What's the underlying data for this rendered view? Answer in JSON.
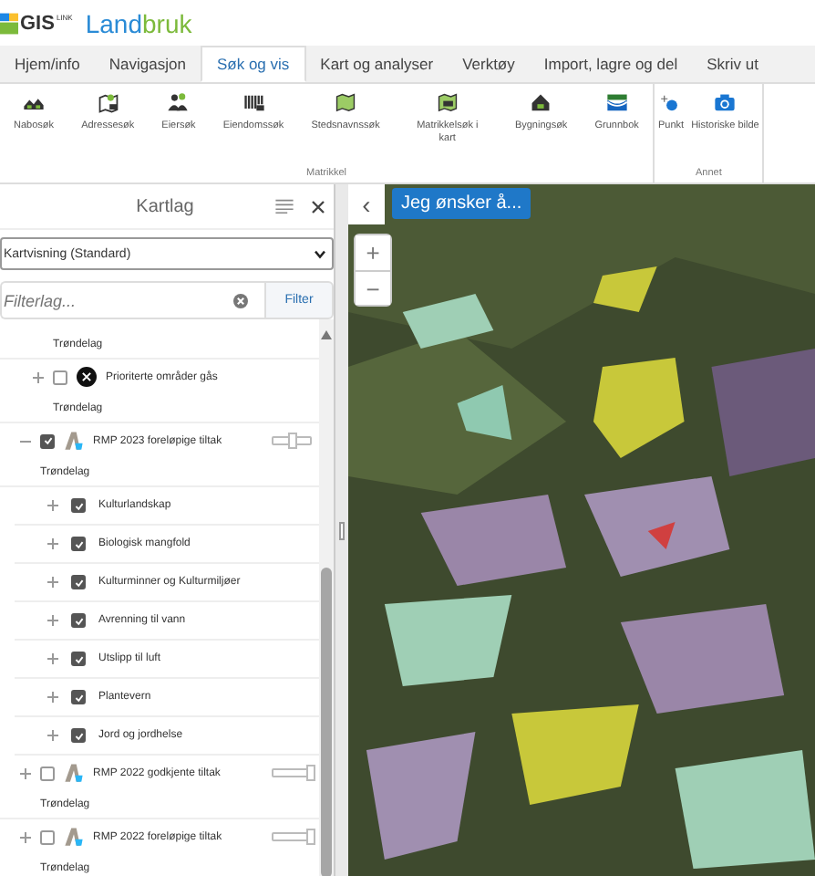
{
  "header": {
    "logo_text": "GIS",
    "logo_badge": "LINK",
    "app_name_parts": [
      "Land",
      "bruk"
    ]
  },
  "tabs": [
    {
      "label": "Hjem/info",
      "selected": false
    },
    {
      "label": "Navigasjon",
      "selected": false
    },
    {
      "label": "Søk og vis",
      "selected": true
    },
    {
      "label": "Kart og analyser",
      "selected": false
    },
    {
      "label": "Verktøy",
      "selected": false
    },
    {
      "label": "Import, lagre og del",
      "selected": false
    },
    {
      "label": "Skriv ut",
      "selected": false
    }
  ],
  "ribbon_groups": [
    {
      "label": "Matrikkel",
      "tools": [
        {
          "label": "Nabosøk"
        },
        {
          "label": "Adressesøk"
        },
        {
          "label": "Eiersøk"
        },
        {
          "label": "Eiendomssøk"
        },
        {
          "label": "Stedsnavnssøk"
        },
        {
          "label": "Matrikkelsøk i kart"
        },
        {
          "label": "Bygningsøk"
        },
        {
          "label": "Grunnbok"
        }
      ]
    },
    {
      "label": "Annet",
      "tools": [
        {
          "label": "Punkt"
        },
        {
          "label": "Historiske bilde"
        }
      ]
    }
  ],
  "layers_panel": {
    "title": "Kartlag",
    "view_select": "Kartvisning (Standard)",
    "filter_placeholder": "Filterlag...",
    "filter_button": "Filter",
    "layers": [
      {
        "kind": "layer",
        "subtitle": "Trøndelag"
      },
      {
        "kind": "layer",
        "name": "Prioriterte områder gås",
        "expanded": false,
        "checked": false,
        "subtitle": "Trøndelag"
      },
      {
        "kind": "group",
        "name": "RMP 2023 foreløpige tiltak",
        "expanded": true,
        "checked": true,
        "level": 0.5,
        "subtitle": "Trøndelag",
        "children": [
          {
            "name": "Kulturlandskap",
            "checked": true
          },
          {
            "name": "Biologisk mangfold",
            "checked": true
          },
          {
            "name": "Kulturminner og Kulturmiljøer",
            "checked": true
          },
          {
            "name": "Avrenning til vann",
            "checked": true
          },
          {
            "name": "Utslipp til luft",
            "checked": true
          },
          {
            "name": "Plantevern",
            "checked": true
          },
          {
            "name": "Jord og jordhelse",
            "checked": true
          }
        ]
      },
      {
        "kind": "group",
        "name": "RMP 2022 godkjente tiltak",
        "expanded": false,
        "checked": false,
        "level": 1,
        "subtitle": "Trøndelag"
      },
      {
        "kind": "group",
        "name": "RMP 2022 foreløpige tiltak",
        "expanded": false,
        "checked": false,
        "level": 1,
        "subtitle": "Trøndelag"
      }
    ]
  },
  "map": {
    "action_button": "Jeg ønsker å...",
    "zoom_in": "+",
    "zoom_out": "−",
    "collapse": "‹"
  }
}
